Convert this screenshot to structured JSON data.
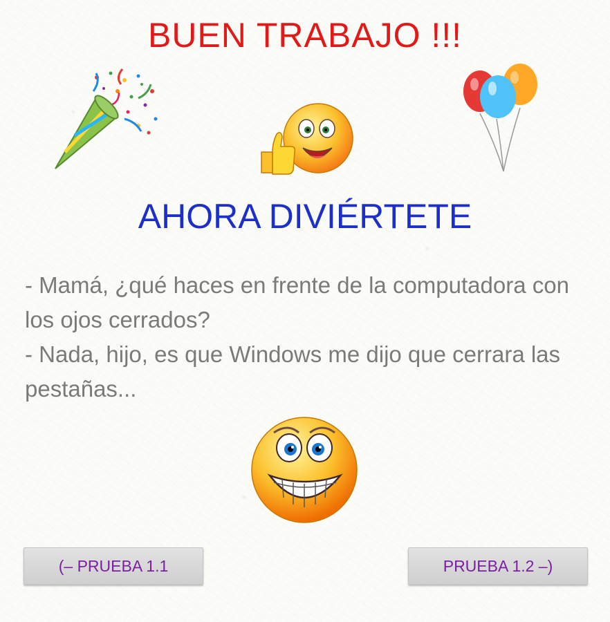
{
  "header": {
    "title": "BUEN TRABAJO !!!"
  },
  "main": {
    "subtitle": "AHORA DIVIÉRTETE",
    "joke_lines": [
      "- Mamá, ¿qué haces en frente de la computadora con los ojos cerrados?",
      "- Nada, hijo, es que Windows me dijo que cerrara las pestañas..."
    ]
  },
  "nav": {
    "prev_label": "(– PRUEBA 1.1",
    "next_label": "PRUEBA 1.2 –)"
  },
  "icons": [
    "party-popper-icon",
    "thumbs-up-smiley-icon",
    "balloons-icon",
    "grinning-smiley-icon"
  ],
  "colors": {
    "title": "#e01919",
    "subtitle": "#1c2fc9",
    "joke_text": "#7a7a7a",
    "button_text": "#7b1fa2",
    "button_bg": "#d9d9d9"
  }
}
